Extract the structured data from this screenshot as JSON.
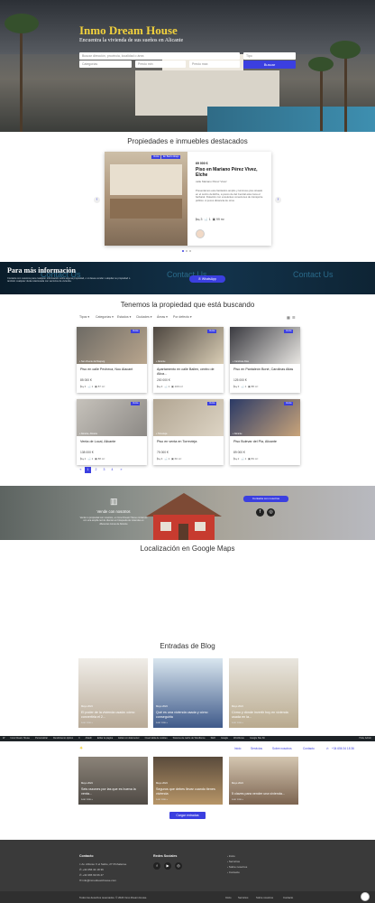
{
  "hero": {
    "title": "Inmo Dream House",
    "subtitle": "Encuentra la vivienda de sus sueños en Alicante",
    "search_placeholder": "Buscar dirección, provincia, localidad o área",
    "type_placeholder": "Tipo",
    "category_placeholder": "Categorías",
    "min_price": "Precio min",
    "max_price": "Precio max",
    "search_button": "Buscar"
  },
  "featured": {
    "title": "Propiedades e inmuebles destacados",
    "tag1": "Venta",
    "tag2": "En Barrio Abajo",
    "price": "69 000 €",
    "name": "Piso en Mariano Pérez Vivez, Elche",
    "address": "calle Mariano Pérez Vivez",
    "description": "Presentamos este fantástico amplio y luminoso piso situado en el centro de Elche, a pocos de del Central esta zona el barbaral. Dotación con excelentes conexiones de transporte público. A pocos distancia de otros",
    "beds": "3",
    "baths": "1",
    "area": "99 m²",
    "prev": "‹",
    "next": "›"
  },
  "contact_band": {
    "title": "Para más información",
    "text": "Contacte con nosotros para cualquier información sobre alguna propiedad, o si desea vender o alquilar su propiedad o también cualquier duda relacionada con servicios de vivienda.",
    "ghost1": "Contact Us",
    "ghost2": "Contact Us",
    "ghost3": "Contact Us",
    "whatsapp": "WhatsApp"
  },
  "listing": {
    "title": "Tenemos la propiedad que está buscando",
    "filters": [
      "Tipos",
      "Categorías",
      "Estados",
      "Ciudades",
      "Áreas",
      "Por defecto"
    ],
    "cards": [
      {
        "tag": "Venta",
        "loc": "San Vicente del Raspeig",
        "title": "Piso en calle Pecheca, Nou Alacant",
        "price": "85 000 €",
        "beds": "3",
        "baths": "1",
        "area": "87 m²",
        "c1": "#6d6a64",
        "c2": "#b9a68e"
      },
      {
        "tag": "Venta",
        "loc": "Alicante",
        "title": "Apartamento en calle Bailen, centro de Alica...",
        "price": "200 000 €",
        "beds": "3",
        "baths": "1",
        "area": "100 m²",
        "c1": "#4d463f",
        "c2": "#d9cdb5"
      },
      {
        "tag": "Venta",
        "loc": "Carolinas Altas",
        "title": "Piso en Pantaleón Boné, Carolinas Altas",
        "price": "125 000 €",
        "beds": "3",
        "baths": "1",
        "area": "88 m²",
        "c1": "#3a3a40",
        "c2": "#e8e6e2"
      },
      {
        "tag": "Venta",
        "loc": "Alicante, Alicante",
        "title": "Venta de Local, Alicante",
        "price": "138 000 €",
        "beds": "2",
        "baths": "1",
        "area": "88 m²",
        "c1": "#c6c2bb",
        "c2": "#8c8985"
      },
      {
        "tag": "Venta",
        "loc": "Torrevieja",
        "title": "Piso en venta en Torrevieja",
        "price": "75 000 €",
        "beds": "3",
        "baths": "1",
        "area": "60 m²",
        "c1": "#b1a592",
        "c2": "#ddd4c4"
      },
      {
        "tag": "Venta",
        "loc": "Alicante",
        "title": "Piso Bulevar del Pla, Alicante",
        "price": "89 000 €",
        "beds": "2",
        "baths": "1",
        "area": "83 m²",
        "c1": "#2b3a66",
        "c2": "#c9a47a"
      }
    ],
    "pages": [
      "«",
      "1",
      "2",
      "3",
      "4",
      "»"
    ]
  },
  "sell": {
    "title": "Vende con nosotros",
    "text": "Vende tu propiedad con nosotros, en Inmo Dream House contamos con una amplia red de clientes en búsqueda de viviendas en diferentes zonas de Alicante",
    "button": "Contacta con nosotros"
  },
  "map": {
    "title": "Localización en Google Maps"
  },
  "blog": {
    "title": "Entradas de Blog",
    "posts": [
      {
        "date": "Mayo 2024",
        "title": "El poder de la vivienda usada: cómo convertirla el 2...",
        "link": "Leer más »",
        "c1": "#f0ede8",
        "c2": "#b8aa97"
      },
      {
        "date": "Mayo 2024",
        "title": "Qué es una vivienda usada y cómo conseguirla",
        "link": "Leer más »",
        "c1": "#d9e6ef",
        "c2": "#3f5a8a"
      },
      {
        "date": "Mayo 2024",
        "title": "Cómo y dónde invertir hoy en vivienda usada en la...",
        "link": "Leer más »",
        "c1": "#e9e6df",
        "c2": "#b9aa8e"
      },
      {
        "date": "Mayo 2024",
        "title": "Seis razones por las que es buena la venta...",
        "link": "Leer más »",
        "c1": "#8b8378",
        "c2": "#4f4a45"
      },
      {
        "date": "Mayo 2024",
        "title": "Seguros que debes llevar cuando tienes vivienda",
        "link": "Leer más »",
        "c1": "#5a4b3c",
        "c2": "#b79567"
      },
      {
        "date": "Mayo 2024",
        "title": "5 claves para vender una vivienda...",
        "link": "Leer más »",
        "c1": "#d4c6b1",
        "c2": "#7c6450"
      }
    ],
    "more_button": "Cargar entradas"
  },
  "overlay_nav": {
    "links": [
      "Inicio",
      "Servicios",
      "Sobre nosotros",
      "Contacto"
    ],
    "phone": "+34 656 34 18 36"
  },
  "admin_bar": {
    "items": [
      "W",
      "Inmo Dream House",
      "Personalizar",
      "Rendimiento óptimo",
      "0",
      "Añadir",
      "Editar la página",
      "Editar con Elementor",
      "Crear tabla de cookies",
      "Sistema de caché de Wordfence",
      "SEO",
      "Google",
      "Wordfence",
      "Google Site Kit",
      "Hola, Admin"
    ]
  },
  "footer": {
    "contact_title": "Contacto",
    "address": "Av. Alfonso X el Sabio, 27 Pinhalense",
    "phone1": "+34 656 34 18 36",
    "phone2": "+34 965 69 66 47",
    "email": "info@inmodreamhouse.com",
    "social_title": "Redes Sociales",
    "links": [
      "Inicio",
      "Servicios",
      "Sobre nosotros",
      "Contacto"
    ],
    "copyright": "Todos los derechos reservados. © 2024 Inmo Dream House.",
    "bottom_links": [
      "Inicio",
      "Servicios",
      "Sobre nosotros",
      "Contacto"
    ]
  },
  "colors": {
    "accent": "#3b3fe0",
    "brand_yellow": "#f3d23c",
    "dark": "#1d2327"
  }
}
